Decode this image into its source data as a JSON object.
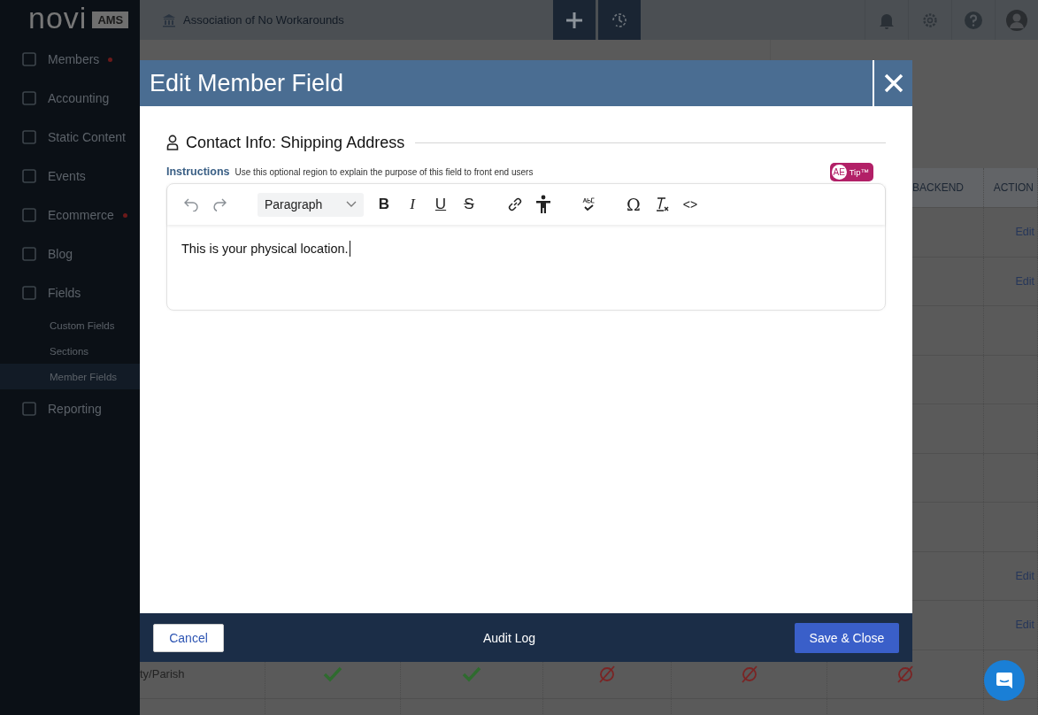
{
  "sidebar": {
    "logo": "novi",
    "logo_badge": "AMS",
    "items": [
      {
        "label": "Members",
        "alert": true,
        "selected": false
      },
      {
        "label": "Accounting",
        "alert": false,
        "selected": false
      },
      {
        "label": "Static Content",
        "alert": false,
        "selected": false
      },
      {
        "label": "Events",
        "alert": false,
        "selected": false
      },
      {
        "label": "Ecommerce",
        "alert": true,
        "selected": false
      },
      {
        "label": "Blog",
        "alert": false,
        "selected": false
      },
      {
        "label": "Fields",
        "alert": false,
        "selected": false,
        "children": [
          {
            "label": "Custom Fields",
            "selected": false
          },
          {
            "label": "Sections",
            "selected": false
          },
          {
            "label": "Member Fields",
            "selected": true
          }
        ]
      },
      {
        "label": "Reporting",
        "alert": false,
        "selected": false
      }
    ]
  },
  "top_bar": {
    "organization": "Association of No Workarounds"
  },
  "table": {
    "columns": [
      {
        "label": "BACKEND"
      },
      {
        "label": "ACTION"
      }
    ],
    "rows": [
      {
        "action": "Edit"
      },
      {
        "action": "Edit"
      },
      {},
      {},
      {},
      {},
      {},
      {
        "action": "Edit"
      },
      {
        "action": "Edit"
      },
      {
        "label": "ty/Parish",
        "values": [
          true,
          true,
          false,
          false,
          false
        ]
      }
    ]
  },
  "modal": {
    "title": "Edit Member Field",
    "section_title": "Contact Info: Shipping Address",
    "instructions_label": "Instructions",
    "instructions_text": "Use this optional region to explain the purpose of this field to front end users",
    "tip_badge": {
      "initials": "AE",
      "label": "Tip™"
    },
    "editor": {
      "block_format": "Paragraph",
      "buttons": [
        {
          "kind": "bold",
          "label": "B"
        },
        {
          "kind": "italic",
          "label": "I"
        },
        {
          "kind": "underline",
          "label": "U"
        },
        {
          "kind": "strike",
          "label": "S"
        },
        {
          "kind": "link"
        },
        {
          "kind": "accessibility"
        },
        {
          "kind": "spellcheck"
        },
        {
          "kind": "symbol",
          "label": "Ω"
        },
        {
          "kind": "clear-format"
        },
        {
          "kind": "source",
          "label": "<>"
        }
      ],
      "content": "This is your physical location."
    },
    "footer": {
      "cancel": "Cancel",
      "audit_log": "Audit Log",
      "save": "Save & Close"
    }
  }
}
